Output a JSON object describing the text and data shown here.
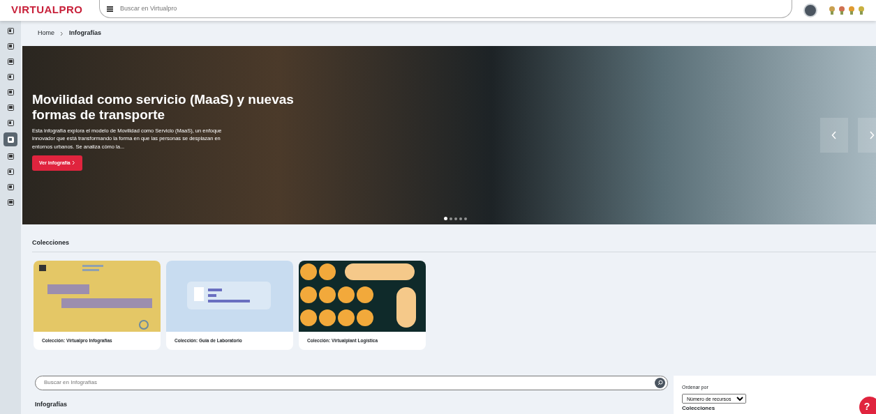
{
  "header": {
    "logo": "VIRTUALPRO",
    "search": {
      "placeholder": "Buscar en Virtualpro"
    }
  },
  "sidebar": {
    "items": [
      {
        "selected": false
      },
      {
        "selected": false
      },
      {
        "selected": false
      },
      {
        "selected": false
      },
      {
        "selected": false
      },
      {
        "selected": false
      },
      {
        "selected": false
      },
      {
        "selected": true
      },
      {
        "selected": false
      },
      {
        "selected": false
      },
      {
        "selected": false
      },
      {
        "selected": false
      }
    ]
  },
  "breadcrumb": [
    "Home",
    "Infografías"
  ],
  "hero": {
    "title": "Movilidad como servicio (MaaS) y nuevas formas de transporte",
    "description": "Esta infografía explora el modelo de Movilidad como Servicio (MaaS), un enfoque innovador que está transformando la forma en que las personas se desplazan en entornos urbanos. Se analiza cómo la...",
    "button": "Ver infografía",
    "dots": [
      {
        "selected": true
      },
      {
        "selected": false
      },
      {
        "selected": false
      },
      {
        "selected": false
      },
      {
        "selected": false
      }
    ]
  },
  "collections": {
    "heading": "Colecciones",
    "items": [
      {
        "kind": "infografias",
        "label": "Colección: Virtualpro Infografías"
      },
      {
        "kind": "laboratorio",
        "label": "Colección: Guía de Laboratorio"
      },
      {
        "kind": "logistica",
        "label": "Colección: Virtualplant Logística"
      }
    ]
  },
  "resources": {
    "search": {
      "placeholder": "Buscar en Infografías"
    },
    "title": "Infografías"
  },
  "filters": {
    "sort_label": "Ordenar por",
    "sort_value": "Número de recursos",
    "next_heading": "Colecciones"
  },
  "help": "?"
}
